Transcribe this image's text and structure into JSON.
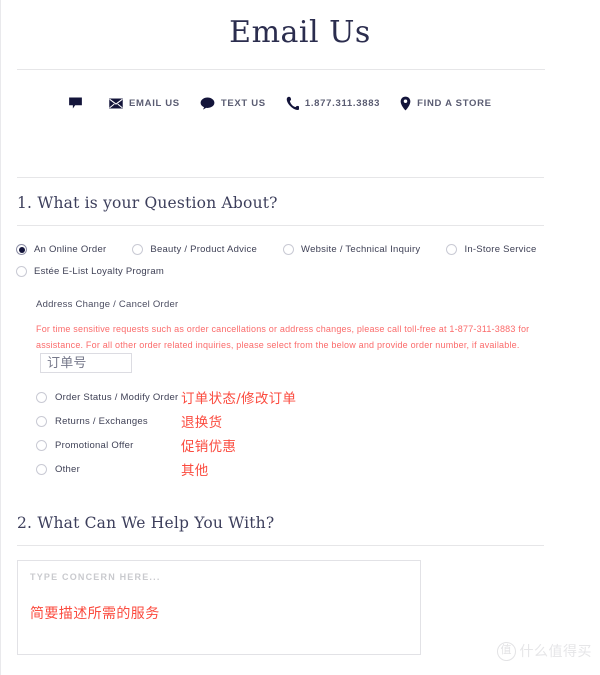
{
  "page": {
    "title": "Email Us"
  },
  "contact_bar": {
    "items": [
      {
        "icon": "chat-bubble-icon",
        "label": ""
      },
      {
        "icon": "envelope-icon",
        "label": "EMAIL US"
      },
      {
        "icon": "speech-bubble-icon",
        "label": "TEXT US"
      },
      {
        "icon": "phone-icon",
        "label": "1.877.311.3883"
      },
      {
        "icon": "map-pin-icon",
        "label": "FIND A STORE"
      }
    ]
  },
  "section1": {
    "title": "1. What is your Question About?",
    "options": [
      {
        "label": "An Online Order",
        "selected": true
      },
      {
        "label": "Beauty / Product Advice",
        "selected": false
      },
      {
        "label": "Website / Technical Inquiry",
        "selected": false
      },
      {
        "label": "In-Store Service",
        "selected": false
      },
      {
        "label": "Estée E-List Loyalty Program",
        "selected": false
      }
    ],
    "nested": {
      "heading": "Address Change / Cancel Order",
      "warning_text": "For time sensitive requests such as order cancellations or address changes, please call toll-free at 1-877-311-3883 for assistance. For all other order related inquiries, please select from the below and provide order number, if available.",
      "order_input_value": "订单号",
      "sub_options": [
        {
          "label": "Order Status / Modify Order",
          "annotation": "订单状态/修改订单",
          "selected": false
        },
        {
          "label": "Returns / Exchanges",
          "annotation": "退换货",
          "selected": false
        },
        {
          "label": "Promotional Offer",
          "annotation": "促销优惠",
          "selected": false
        },
        {
          "label": "Other",
          "annotation": "其他",
          "selected": false
        }
      ]
    }
  },
  "section2": {
    "title": "2. What Can We Help You With?",
    "textarea_placeholder": "TYPE CONCERN HERE...",
    "textarea_annotation": "简要描述所需的服务"
  },
  "watermark": {
    "logo_char": "值",
    "text": "什么值得买"
  },
  "colors": {
    "title_navy": "#2b2d4e",
    "warning_red": "#fb6b6b",
    "annotation_red": "#fb4b3f",
    "rule_gray": "#e6e6e8"
  }
}
